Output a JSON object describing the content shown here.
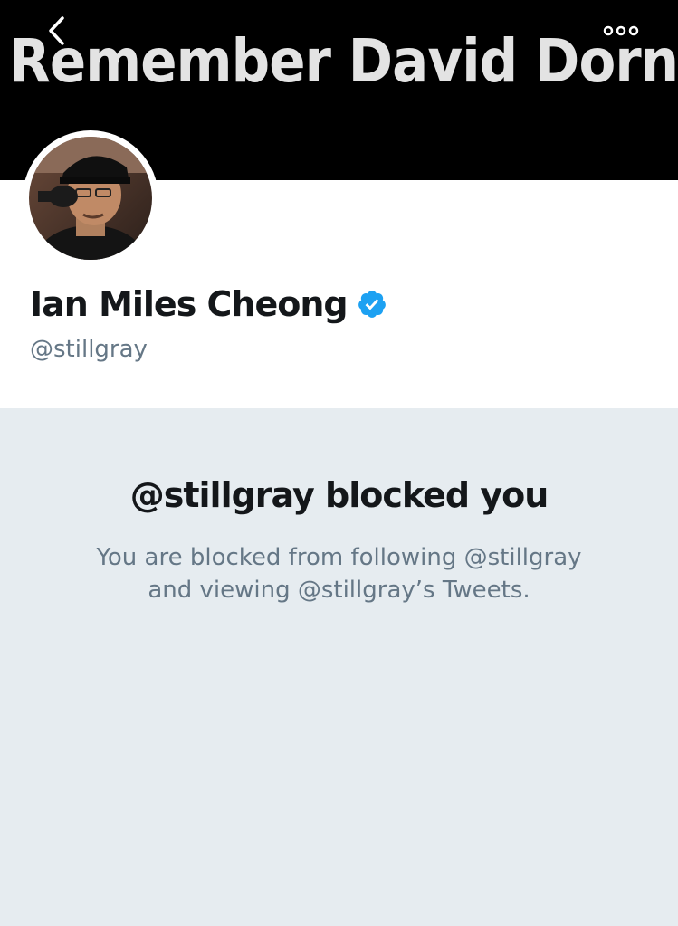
{
  "header": {
    "banner_text": "Remember David Dorn",
    "back_icon": "chevron-left-icon",
    "more_icon": "more-horizontal-icon"
  },
  "profile": {
    "display_name": "Ian Miles Cheong",
    "handle": "@stillgray",
    "verified": true,
    "verified_color": "#1da1f2"
  },
  "blocked_notice": {
    "title": "@stillgray blocked you",
    "line1": "You are blocked from following @stillgray",
    "line2": "and viewing @stillgray’s Tweets."
  },
  "colors": {
    "background": "#e6ecf0",
    "primary_text": "#14171a",
    "secondary_text": "#657786"
  }
}
